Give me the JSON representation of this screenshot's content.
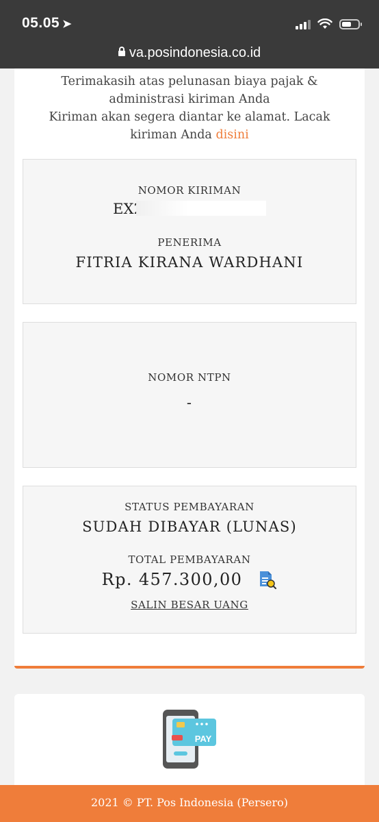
{
  "status_bar": {
    "time": "05.05",
    "url": "va.posindonesia.co.id"
  },
  "intro": {
    "line1": "Terimakasih atas pelunasan biaya pajak & administrasi kiriman Anda",
    "line2_prefix": "Kiriman akan segera diantar ke alamat. Lacak kiriman Anda ",
    "link": "disini"
  },
  "shipment": {
    "number_label": "NOMOR KIRIMAN",
    "number_visible": "EX2",
    "recipient_label": "PENERIMA",
    "recipient": "FITRIA KIRANA WARDHANI"
  },
  "ntpn": {
    "label": "NOMOR NTPN",
    "value": "-"
  },
  "payment": {
    "status_label": "STATUS PEMBAYARAN",
    "status": "SUDAH DIBAYAR (LUNAS)",
    "total_label": "TOTAL PEMBAYARAN",
    "total": "Rp. 457.300,00",
    "copy_label": "SALIN BESAR UANG"
  },
  "promo": {
    "pay_label": "PAY"
  },
  "footer": {
    "text": "2021 © PT. Pos Indonesia (Persero)"
  },
  "colors": {
    "accent": "#ef7d3a",
    "topbar": "#3a3a3a"
  }
}
